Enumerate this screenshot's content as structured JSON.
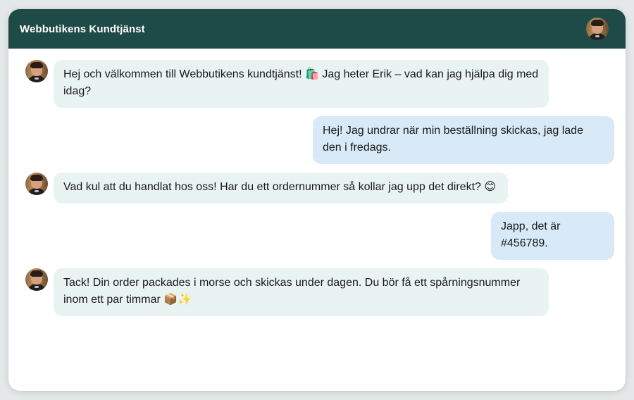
{
  "header": {
    "title": "Webbutikens Kundtjänst",
    "avatar_icon": "agent-avatar-icon"
  },
  "colors": {
    "header_bg": "#1e4a47",
    "agent_bubble": "#e8f3f2",
    "user_bubble": "#d8e9f7",
    "page_bg": "#e4e8e8"
  },
  "messages": [
    {
      "sender": "agent",
      "text": "Hej och välkommen till Webbutikens kundtjänst! 🛍️ Jag heter Erik – vad kan jag hjälpa dig med idag?"
    },
    {
      "sender": "user",
      "text": "Hej! Jag undrar när min beställning skickas, jag lade den i fredags."
    },
    {
      "sender": "agent",
      "text": "Vad kul att du handlat hos oss! Har du ett ordernummer så kollar jag upp det direkt? 😊"
    },
    {
      "sender": "user",
      "text": "Japp, det är #456789."
    },
    {
      "sender": "agent",
      "text": "Tack! Din order packades i morse och skickas under dagen. Du bör få ett spårningsnummer inom ett par timmar 📦✨"
    }
  ]
}
